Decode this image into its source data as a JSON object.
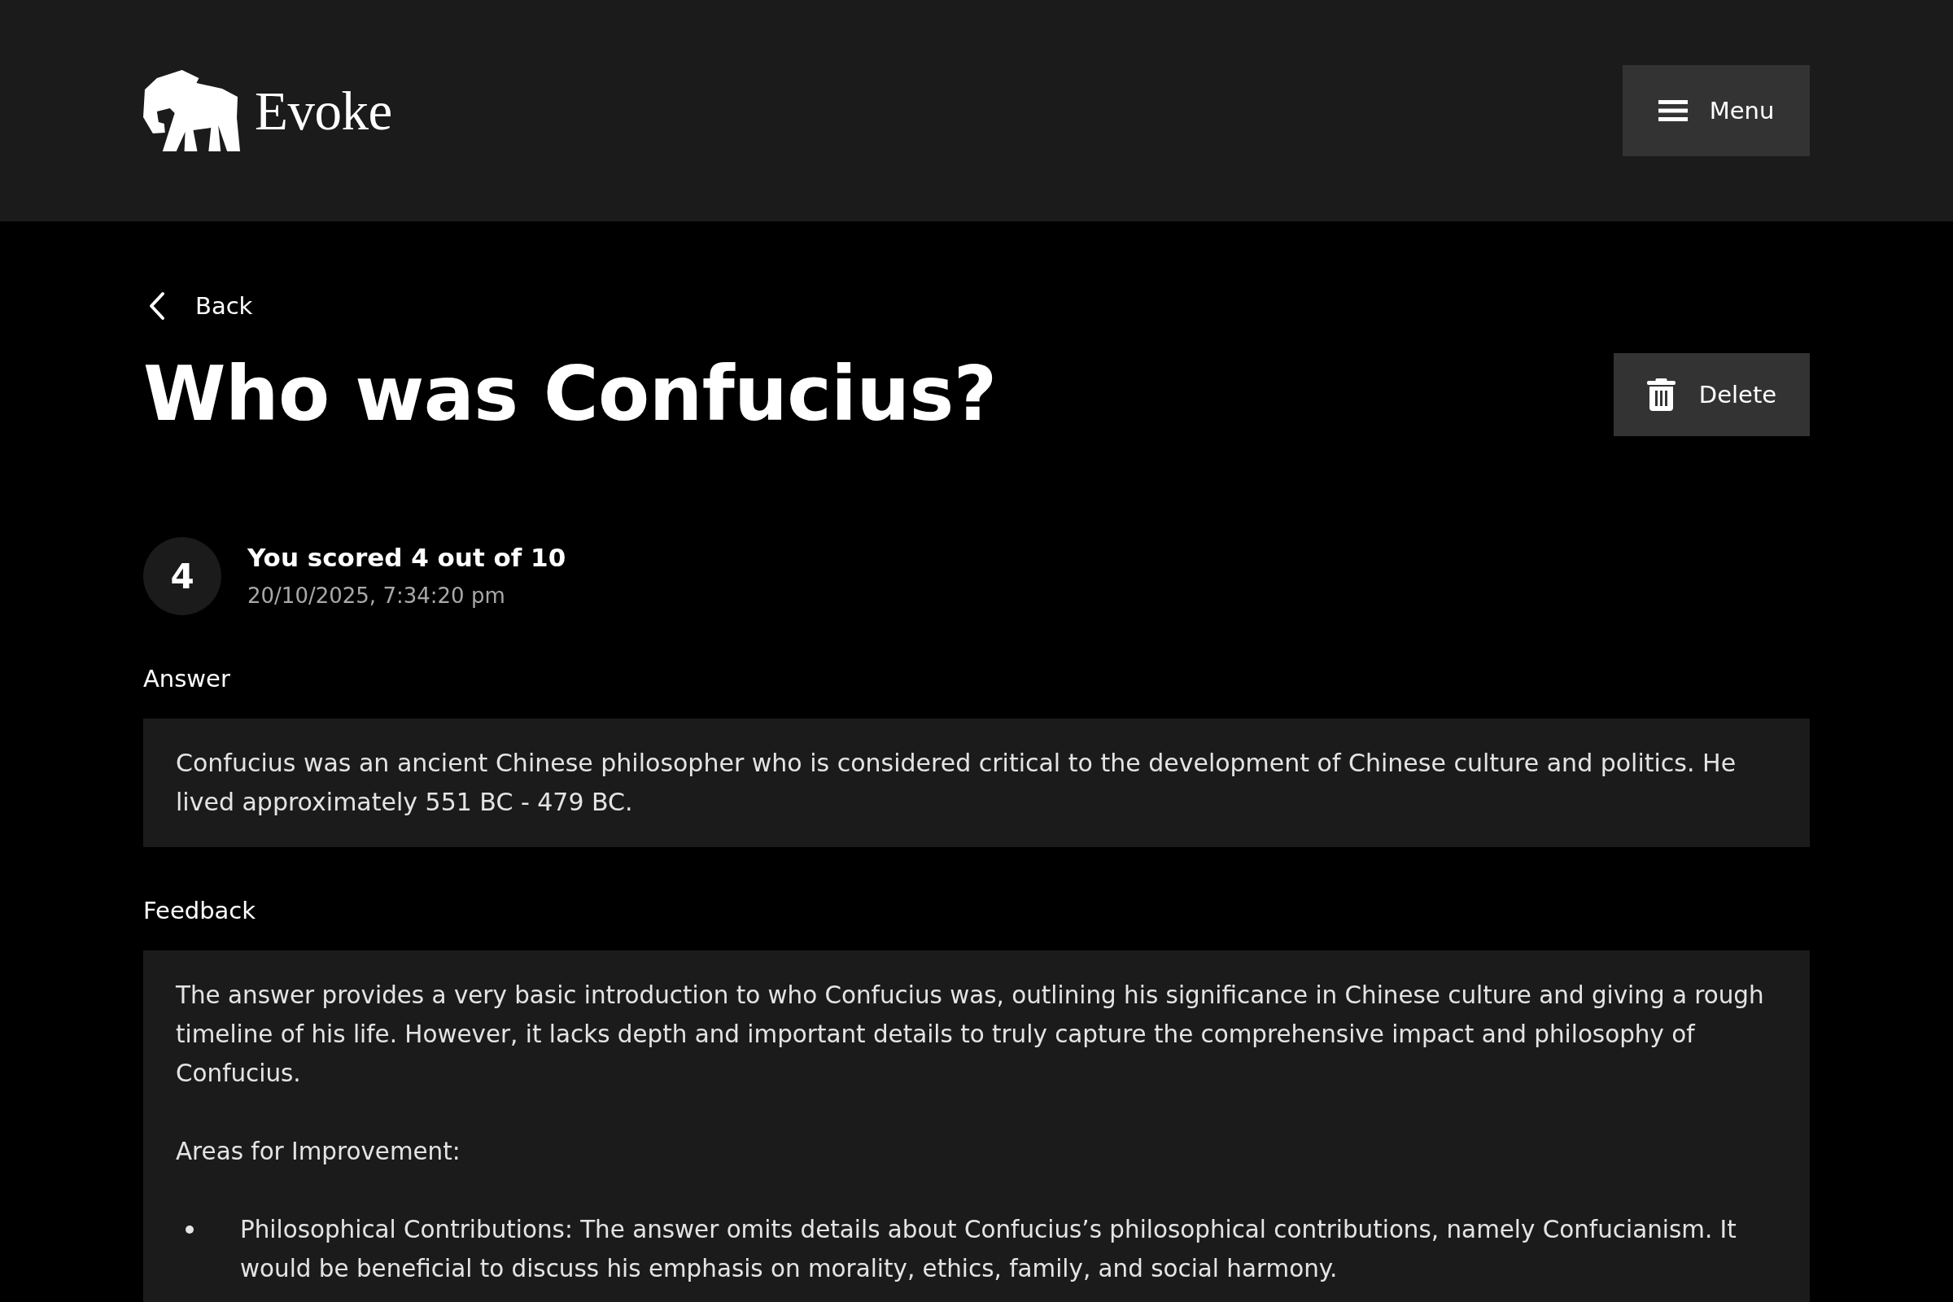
{
  "header": {
    "logo_text": "Evoke",
    "menu_button": "Menu"
  },
  "back_link": "Back",
  "title": "Who was Confucius?",
  "delete_button": "Delete",
  "score": {
    "value": "4",
    "summary": "You scored 4 out of 10",
    "timestamp": "20/10/2025, 7:34:20 pm"
  },
  "answer": {
    "label": "Answer",
    "blocks": [
      {
        "kind": "paragraph",
        "text": "Confucius was an ancient Chinese philosopher who is considered critical to the development of Chinese culture and politics. He lived approximately 551 BC - 479 BC."
      }
    ]
  },
  "feedback": {
    "label": "Feedback",
    "blocks": [
      {
        "kind": "paragraph",
        "text": "The answer provides a very basic introduction to who Confucius was, outlining his significance in Chinese culture and giving a rough timeline of his life. However, it lacks depth and important details to truly capture the comprehensive impact and philosophy of Confucius."
      },
      {
        "kind": "paragraph",
        "text": "Areas for Improvement:"
      },
      {
        "kind": "bullet_list",
        "items": [
          "Philosophical Contributions: The answer omits details about Confucius’s philosophical contributions, namely Confucianism. It would be beneficial to discuss his emphasis on morality, ethics, family, and social harmony."
        ]
      }
    ]
  }
}
